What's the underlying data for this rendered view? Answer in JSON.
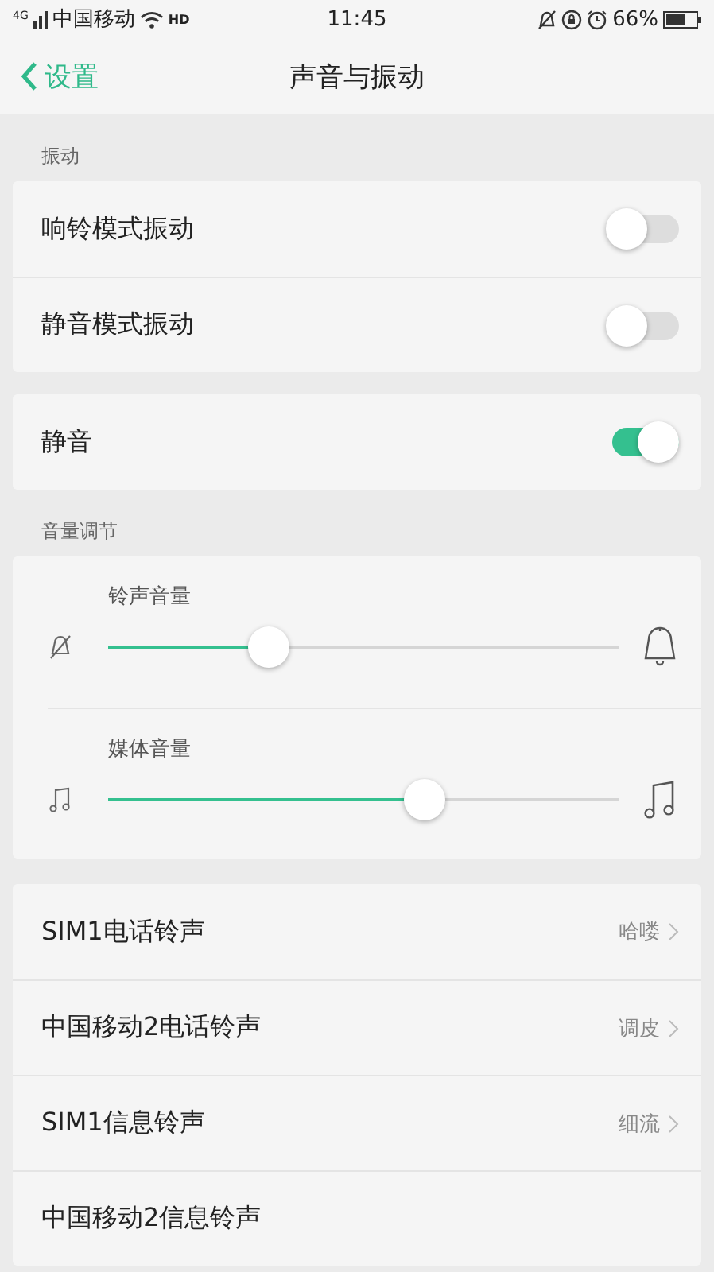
{
  "status_bar": {
    "carrier": "中国移动",
    "network": "4G",
    "call_badge": "HD",
    "time": "11:45",
    "battery": "66%"
  },
  "nav": {
    "back": "设置",
    "title": "声音与振动"
  },
  "vibration": {
    "label": "振动",
    "items": [
      {
        "label": "响铃模式振动",
        "on": false
      },
      {
        "label": "静音模式振动",
        "on": false
      }
    ]
  },
  "silent": {
    "label": "静音",
    "on": true
  },
  "volume": {
    "label": "音量调节",
    "sliders": [
      {
        "kind": "ringtone",
        "label": "铃声音量",
        "level": 0.315
      },
      {
        "kind": "media",
        "label": "媒体音量",
        "level": 0.62
      }
    ]
  },
  "tones": [
    {
      "label": "SIM1电话铃声",
      "value": "哈喽"
    },
    {
      "label": "中国移动2电话铃声",
      "value": "调皮"
    },
    {
      "label": "SIM1信息铃声",
      "value": "细流"
    },
    {
      "label": "中国移动2信息铃声"
    }
  ]
}
